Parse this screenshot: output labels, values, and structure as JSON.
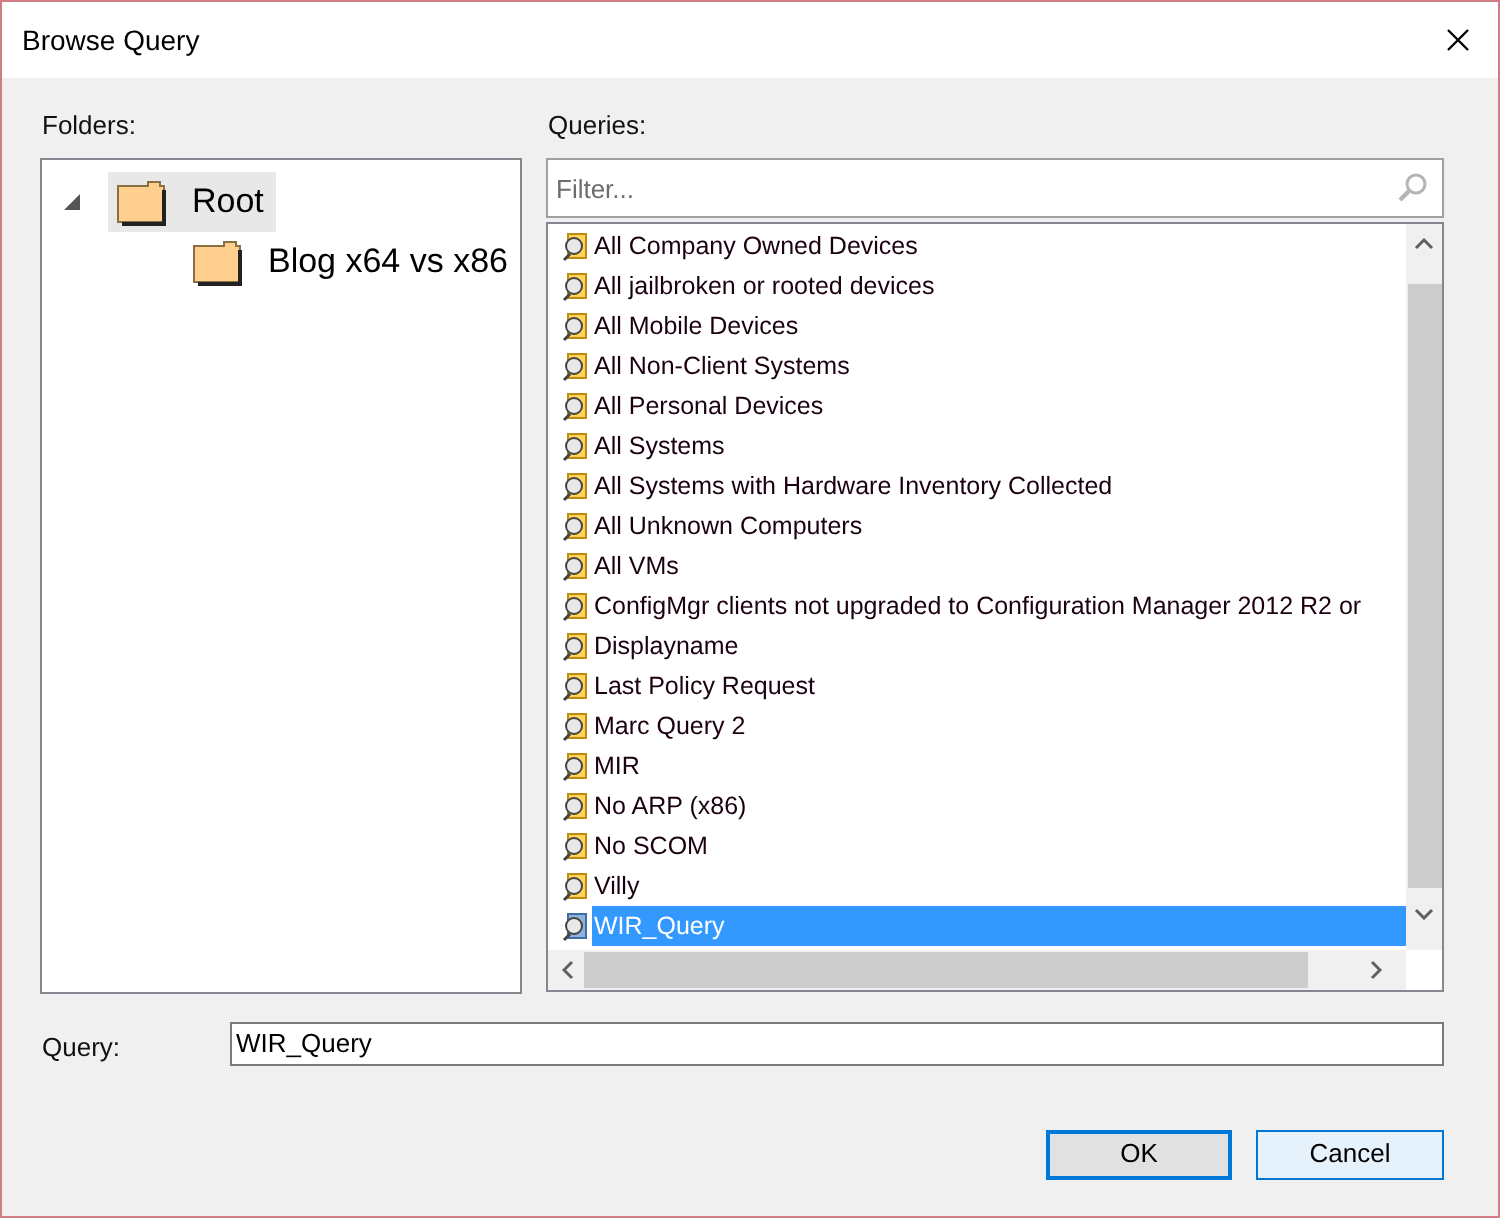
{
  "window": {
    "title": "Browse Query"
  },
  "folders": {
    "label": "Folders:",
    "tree": [
      {
        "label": "Root",
        "expanded": true,
        "selected": true,
        "children": [
          {
            "label": "Blog x64 vs x86",
            "selected": false
          }
        ]
      }
    ]
  },
  "queries": {
    "label": "Queries:",
    "filter": {
      "placeholder": "Filter..."
    },
    "items": [
      {
        "label": "All Company Owned Devices",
        "selected": false
      },
      {
        "label": "All jailbroken or rooted devices",
        "selected": false
      },
      {
        "label": "All Mobile Devices",
        "selected": false
      },
      {
        "label": "All Non-Client Systems",
        "selected": false
      },
      {
        "label": "All Personal Devices",
        "selected": false
      },
      {
        "label": "All Systems",
        "selected": false
      },
      {
        "label": "All Systems with Hardware Inventory Collected",
        "selected": false
      },
      {
        "label": "All Unknown Computers",
        "selected": false
      },
      {
        "label": "All VMs",
        "selected": false
      },
      {
        "label": "ConfigMgr clients not upgraded to Configuration Manager 2012 R2 or",
        "selected": false
      },
      {
        "label": "Displayname",
        "selected": false
      },
      {
        "label": "Last Policy Request",
        "selected": false
      },
      {
        "label": "Marc Query 2",
        "selected": false
      },
      {
        "label": "MIR",
        "selected": false
      },
      {
        "label": "No ARP (x86)",
        "selected": false
      },
      {
        "label": "No SCOM",
        "selected": false
      },
      {
        "label": "Villy",
        "selected": false
      },
      {
        "label": "WIR_Query",
        "selected": true
      }
    ]
  },
  "query": {
    "label": "Query:",
    "value": "WIR_Query"
  },
  "buttons": [
    {
      "label": "OK",
      "default": true
    },
    {
      "label": "Cancel",
      "default": false
    }
  ]
}
